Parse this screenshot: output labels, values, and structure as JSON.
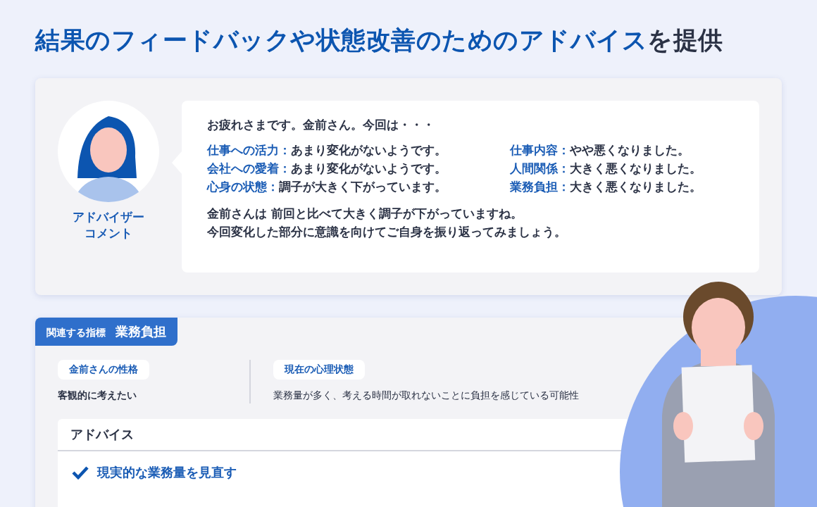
{
  "title": "**結果のフィードバックや状態改善のためのアドバイス**を提供",
  "advisor": {
    "label": [
      "アドバイザー",
      "コメント"
    ]
  },
  "comment": {
    "greeting": "お疲れさまです。金前さん。今回は・・・",
    "results": [
      {
        "label": "仕事への活力：",
        "text": "あまり変化がないようです。"
      },
      {
        "label": "仕事内容：",
        "text": "やや悪くなりました。"
      },
      {
        "label": "会社への愛着：",
        "text": "あまり変化がないようです。"
      },
      {
        "label": "人間関係：",
        "text": "大きく悪くなりました。"
      },
      {
        "label": "心身の状態：",
        "text": "調子が大きく下がっています。"
      },
      {
        "label": "業務負担：",
        "text": "大きく悪くなりました。"
      }
    ],
    "summary": [
      "金前さんは 前回と比べて大きく調子が下がっていますね。",
      "今回変化した部分に意識を向けてご自身を振り返ってみましょう。"
    ]
  },
  "indicator": {
    "label": "関連する指標",
    "value": "業務負担"
  },
  "traits": [
    {
      "heading": "金前さんの性格",
      "text": "客観的に考えたい"
    },
    {
      "heading": "現在の心理状態",
      "text": "業務量が多く、考える時間が取れないことに負担を感じている可能性"
    }
  ],
  "advice": {
    "heading": "アドバイス",
    "items": [
      {
        "text": "現実的な業務量を見直す"
      }
    ]
  }
}
